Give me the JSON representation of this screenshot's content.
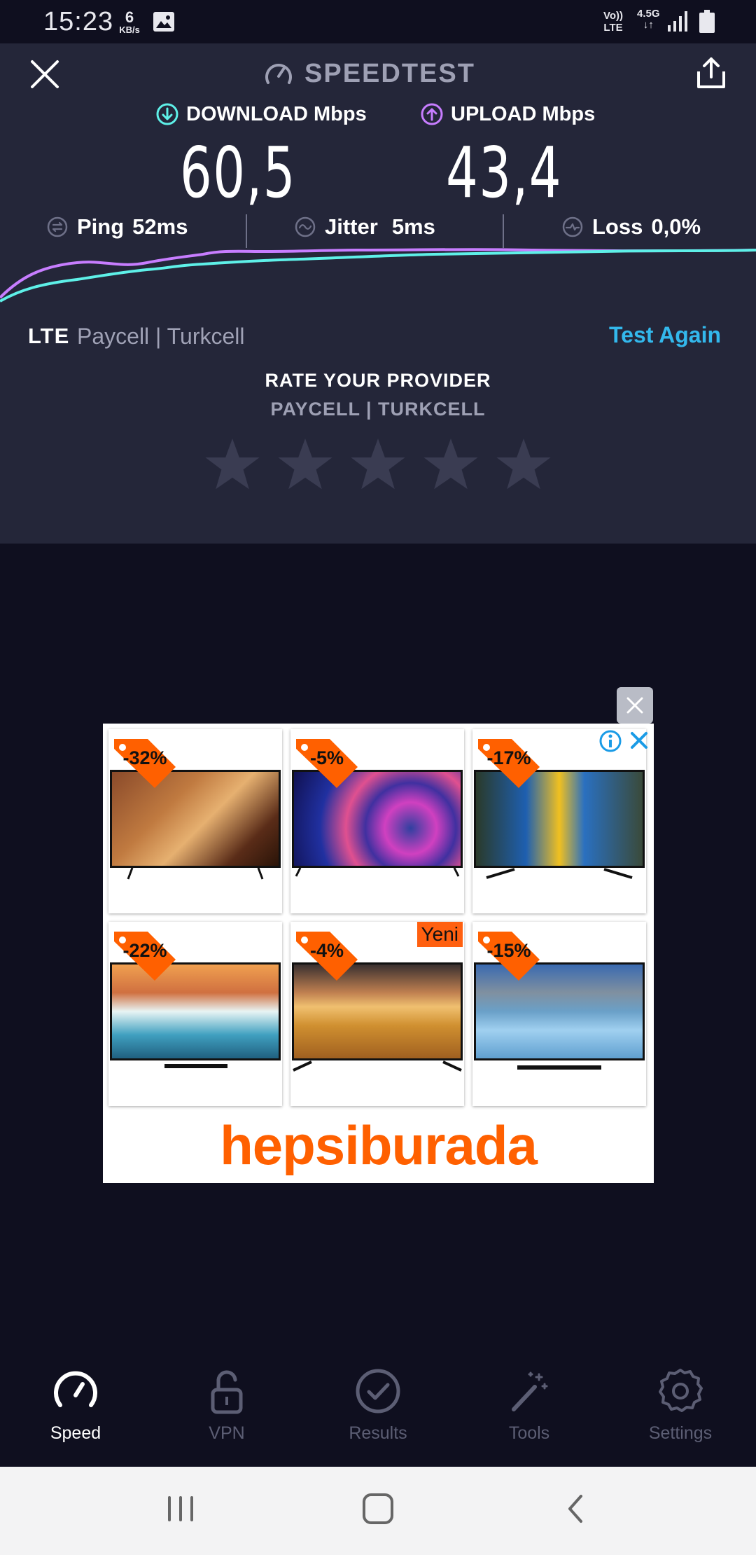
{
  "status_bar": {
    "time": "15:23",
    "net_speed_value": "6",
    "net_speed_unit": "KB/s",
    "volte_line1": "Vo))",
    "volte_line2": "LTE",
    "network_line1": "4.5G",
    "network_line2": "↓↑"
  },
  "header": {
    "title": "SPEEDTEST"
  },
  "results": {
    "download_label": "DOWNLOAD Mbps",
    "upload_label": "UPLOAD Mbps",
    "download_value": "60,5",
    "upload_value": "43,4",
    "ping_label": "Ping",
    "ping_value": "52ms",
    "jitter_label": "Jitter",
    "jitter_value": "5ms",
    "loss_label": "Loss",
    "loss_value": "0,0%"
  },
  "connection": {
    "type": "LTE",
    "carrier": "Paycell | Turkcell",
    "test_again": "Test Again"
  },
  "rating": {
    "title": "RATE YOUR PROVIDER",
    "provider": "PAYCELL | TURKCELL",
    "stars": 5
  },
  "ad": {
    "brand": "hepsiburada",
    "new_badge": "Yeni",
    "discounts": [
      "-32%",
      "-5%",
      "-17%",
      "-22%",
      "-4%",
      "-15%"
    ]
  },
  "bottom_nav": {
    "items": [
      {
        "label": "Speed",
        "icon": "speedometer-icon",
        "active": true
      },
      {
        "label": "VPN",
        "icon": "lock-icon",
        "active": false
      },
      {
        "label": "Results",
        "icon": "check-circle-icon",
        "active": false
      },
      {
        "label": "Tools",
        "icon": "magic-wand-icon",
        "active": false
      },
      {
        "label": "Settings",
        "icon": "gear-icon",
        "active": false
      }
    ]
  },
  "colors": {
    "download": "#5ef0e8",
    "upload": "#c77dff",
    "accent": "#33b8ec",
    "ad_orange": "#ff6000"
  }
}
